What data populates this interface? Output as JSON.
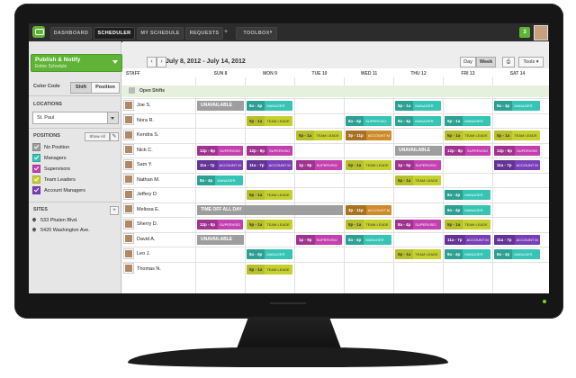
{
  "nav": {
    "tabs": [
      "DASHBOARD",
      "SCHEDULER",
      "MY SCHEDULE",
      "REQUESTS",
      "TOOLBOX"
    ],
    "active": "SCHEDULER",
    "notification_count": "3"
  },
  "sidebar": {
    "publish_title": "Publish & Notify",
    "publish_sub": "Entire Schedule",
    "color_code_label": "Color Code",
    "color_code_options": [
      "Shift",
      "Position"
    ],
    "locations_label": "LOCATIONS",
    "location_value": "St. Paul",
    "positions_label": "POSITIONS",
    "show_all": "Show All",
    "positions": [
      {
        "label": "No Position",
        "color": "#9e9e9e"
      },
      {
        "label": "Managers",
        "color": "#36c4b4"
      },
      {
        "label": "Supervisors",
        "color": "#c43fb0"
      },
      {
        "label": "Team Leaders",
        "color": "#c7d12e"
      },
      {
        "label": "Account Managers",
        "color": "#7a3fb8"
      }
    ],
    "sites_label": "SITES",
    "sites": [
      "533 Phalen Blvd.",
      "5420 Washington Ave."
    ]
  },
  "header": {
    "date_range": "July 8, 2012 - July 14, 2012",
    "views": [
      "Day",
      "Week"
    ],
    "active_view": "Week",
    "tools": "Tools",
    "print_icon": "printer-icon"
  },
  "grid": {
    "staff_header": "STAFF",
    "days": [
      "SUN 8",
      "MON 9",
      "TUE 10",
      "WED 11",
      "THU 12",
      "FRI 13",
      "SAT 14"
    ],
    "open_shifts": "Open Shifts",
    "staff": [
      "Joe S.",
      "Nora R.",
      "Kendra S.",
      "Nick C.",
      "Sam Y.",
      "Nathan M.",
      "Jeffery D.",
      "Melissa E.",
      "Sherry D.",
      "David A.",
      "Leo J.",
      "Thomas N."
    ],
    "shifts": [
      {
        "row": 0,
        "day": 0,
        "status": "UNAVAILABLE",
        "color": "#9e9e9e",
        "span": 1
      },
      {
        "row": 0,
        "day": 1,
        "time": "8a - 4p",
        "role": "MANAGER",
        "color": "#36c4b4"
      },
      {
        "row": 0,
        "day": 4,
        "time": "5p - 1a",
        "role": "MANAGER",
        "color": "#36c4b4"
      },
      {
        "row": 0,
        "day": 6,
        "time": "8a - 4p",
        "role": "MANAGER",
        "color": "#36c4b4"
      },
      {
        "row": 1,
        "day": 1,
        "time": "5p - 1a",
        "role": "TEAM LEADE",
        "color": "#c7d12e",
        "dark": true
      },
      {
        "row": 1,
        "day": 3,
        "time": "8a - 4p",
        "role": "SUPERVISO",
        "color": "#36c4b4"
      },
      {
        "row": 1,
        "day": 4,
        "time": "8a - 4p",
        "role": "MANAGER",
        "color": "#36c4b4"
      },
      {
        "row": 1,
        "day": 5,
        "time": "5p - 1a",
        "role": "MANAGER",
        "color": "#36c4b4"
      },
      {
        "row": 2,
        "day": 2,
        "time": "5p - 1a",
        "role": "TEAM LEADE",
        "color": "#c7d12e",
        "dark": true
      },
      {
        "row": 2,
        "day": 3,
        "time": "3p - 11p",
        "role": "ACCOUNT M",
        "color": "#cf8a2a"
      },
      {
        "row": 2,
        "day": 5,
        "time": "5p - 1a",
        "role": "TEAM LEADE",
        "color": "#c7d12e",
        "dark": true
      },
      {
        "row": 2,
        "day": 6,
        "time": "5p - 1a",
        "role": "TEAM LEADE",
        "color": "#c7d12e",
        "dark": true
      },
      {
        "row": 3,
        "day": 0,
        "time": "12p - 8p",
        "role": "SUPERVISO",
        "color": "#c43fb0"
      },
      {
        "row": 3,
        "day": 1,
        "time": "12p - 8p",
        "role": "SUPERVISO",
        "color": "#c43fb0"
      },
      {
        "row": 3,
        "day": 4,
        "status": "UNAVAILABLE",
        "color": "#9e9e9e",
        "span": 1
      },
      {
        "row": 3,
        "day": 5,
        "time": "12p - 8p",
        "role": "SUPERVISO",
        "color": "#c43fb0"
      },
      {
        "row": 3,
        "day": 6,
        "time": "12p - 8p",
        "role": "SUPERVISO",
        "color": "#c43fb0"
      },
      {
        "row": 4,
        "day": 0,
        "time": "11a - 7p",
        "role": "ACCOUNT M",
        "color": "#7a3fb8"
      },
      {
        "row": 4,
        "day": 1,
        "time": "11a - 7p",
        "role": "ACCOUNT M",
        "color": "#7a3fb8"
      },
      {
        "row": 4,
        "day": 2,
        "time": "1p - 9p",
        "role": "SUPERVISO",
        "color": "#c43fb0"
      },
      {
        "row": 4,
        "day": 3,
        "time": "5p - 1a",
        "role": "TEAM LEADE",
        "color": "#c7d12e",
        "dark": true
      },
      {
        "row": 4,
        "day": 4,
        "time": "1p - 9p",
        "role": "SUPERVISO",
        "color": "#c43fb0"
      },
      {
        "row": 4,
        "day": 6,
        "time": "11a - 7p",
        "role": "ACCOUNT M",
        "color": "#7a3fb8"
      },
      {
        "row": 5,
        "day": 0,
        "time": "8a - 4p",
        "role": "MANAGER",
        "color": "#36c4b4"
      },
      {
        "row": 5,
        "day": 4,
        "time": "5p - 1a",
        "role": "TEAM LEADE",
        "color": "#c7d12e",
        "dark": true
      },
      {
        "row": 6,
        "day": 1,
        "time": "5p - 1a",
        "role": "TEAM LEADE",
        "color": "#c7d12e",
        "dark": true
      },
      {
        "row": 6,
        "day": 5,
        "time": "8a - 4p",
        "role": "MANAGER",
        "color": "#36c4b4"
      },
      {
        "row": 7,
        "day": 0,
        "status": "TIME OFF ALL DAY",
        "color": "#9e9e9e",
        "span": 3
      },
      {
        "row": 7,
        "day": 3,
        "time": "3p - 11p",
        "role": "ACCOUNT M",
        "color": "#cf8a2a"
      },
      {
        "row": 7,
        "day": 5,
        "time": "8a - 4p",
        "role": "MANAGER",
        "color": "#36c4b4"
      },
      {
        "row": 8,
        "day": 0,
        "time": "12p - 8p",
        "role": "SUPERVISO",
        "color": "#c43fb0"
      },
      {
        "row": 8,
        "day": 1,
        "time": "5p - 1a",
        "role": "TEAM LEADE",
        "color": "#c7d12e",
        "dark": true
      },
      {
        "row": 8,
        "day": 3,
        "time": "5p - 1a",
        "role": "TEAM LEADE",
        "color": "#c7d12e",
        "dark": true
      },
      {
        "row": 8,
        "day": 4,
        "time": "8a - 4p",
        "role": "SUPERVISO",
        "color": "#c43fb0"
      },
      {
        "row": 8,
        "day": 5,
        "time": "5p - 1a",
        "role": "TEAM LEADE",
        "color": "#c7d12e",
        "dark": true
      },
      {
        "row": 9,
        "day": 0,
        "status": "UNAVAILABLE",
        "color": "#9e9e9e",
        "span": 1
      },
      {
        "row": 9,
        "day": 2,
        "time": "1p - 9p",
        "role": "SUPERVISO",
        "color": "#c43fb0"
      },
      {
        "row": 9,
        "day": 3,
        "time": "8a - 4p",
        "role": "MANAGER",
        "color": "#36c4b4"
      },
      {
        "row": 9,
        "day": 5,
        "time": "11a - 7p",
        "role": "ACCOUNT M",
        "color": "#7a3fb8"
      },
      {
        "row": 9,
        "day": 6,
        "time": "11a - 7p",
        "role": "ACCOUNT M",
        "color": "#7a3fb8"
      },
      {
        "row": 10,
        "day": 1,
        "time": "8a - 4p",
        "role": "MANAGER",
        "color": "#36c4b4"
      },
      {
        "row": 10,
        "day": 4,
        "time": "5p - 1a",
        "role": "TEAM LEADE",
        "color": "#c7d12e",
        "dark": true
      },
      {
        "row": 10,
        "day": 5,
        "time": "8a - 4p",
        "role": "MANAGER",
        "color": "#36c4b4"
      },
      {
        "row": 10,
        "day": 6,
        "time": "8a - 4p",
        "role": "MANAGER",
        "color": "#36c4b4"
      },
      {
        "row": 11,
        "day": 1,
        "time": "5p - 1a",
        "role": "TEAM LEADE",
        "color": "#c7d12e",
        "dark": true
      }
    ]
  }
}
